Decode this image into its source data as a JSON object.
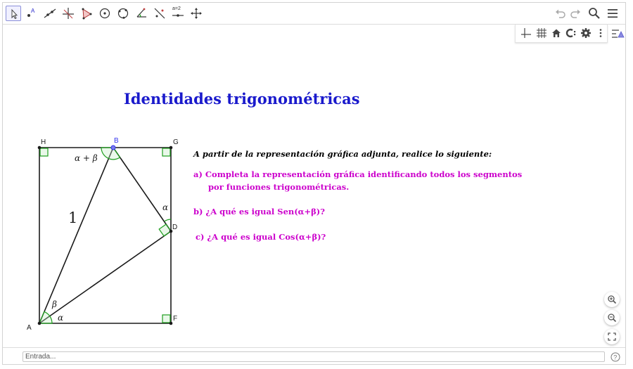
{
  "toolbar": {
    "tools": [
      {
        "name": "move-tool",
        "icon": "cursor-arrow"
      },
      {
        "name": "point-tool",
        "icon": "point-a"
      },
      {
        "name": "line-tool",
        "icon": "line-through-points"
      },
      {
        "name": "perpendicular-line-tool",
        "icon": "perpendicular-lines"
      },
      {
        "name": "polygon-tool",
        "icon": "triangle"
      },
      {
        "name": "circle-tool",
        "icon": "circle-center-point"
      },
      {
        "name": "circle-three-points-tool",
        "icon": "circle-three-points"
      },
      {
        "name": "angle-tool",
        "icon": "angle"
      },
      {
        "name": "reflect-tool",
        "icon": "reflect-about-line"
      },
      {
        "name": "slider-tool",
        "icon": "slider"
      },
      {
        "name": "move-graphics-tool",
        "icon": "move-cross"
      }
    ],
    "slider_label": "a=2",
    "selected_tool": "move-tool"
  },
  "top_right": {
    "undo_icon": "undo-icon",
    "redo_icon": "redo-icon",
    "search_icon": "search-icon",
    "menu_icon": "menu-icon"
  },
  "stylebar": {
    "buttons": [
      "axes-icon",
      "grid-icon",
      "home-icon",
      "point-capture-icon",
      "settings-icon",
      "more-icon"
    ],
    "collapse_icon": "stylebar-toggle-icon"
  },
  "content": {
    "title": "Identidades trigonométricas",
    "instructions": "A partir de la representación gráfica adjunta, realice lo siguiente:",
    "item_a_line1": "a)  Completa la representación gráfica identificando todos los segmentos",
    "item_a_line2": "por funciones trigonométricas.",
    "item_b": "b)  ¿A qué es igual  Sen(α+β)?",
    "item_c": "c)  ¿A qué es igual  Cos(α+β)?"
  },
  "figure": {
    "points": {
      "A": "A",
      "B": "B",
      "D": "D",
      "F": "F",
      "G": "G",
      "H": "H"
    },
    "hypotenuse_label": "1",
    "angle_labels": {
      "alpha_plus_beta": "α + β",
      "alpha_at_D": "α",
      "beta_at_A": "β",
      "alpha_at_A": "α"
    },
    "colors": {
      "lines": "#1a1a1a",
      "right_angle": "#1e9e1e",
      "angle_arc": "#1e9e1e",
      "point_B": "#3333ee"
    }
  },
  "zoom": {
    "zoom_in_icon": "zoom-in-icon",
    "zoom_out_icon": "zoom-out-icon",
    "fullscreen_icon": "fullscreen-icon"
  },
  "input_bar": {
    "placeholder": "Entrada...",
    "value": "",
    "help_icon": "help-icon"
  },
  "colors": {
    "title": "#1a1acc",
    "items": "#cc00cc",
    "selected_tool_border": "#8b8fd9"
  }
}
